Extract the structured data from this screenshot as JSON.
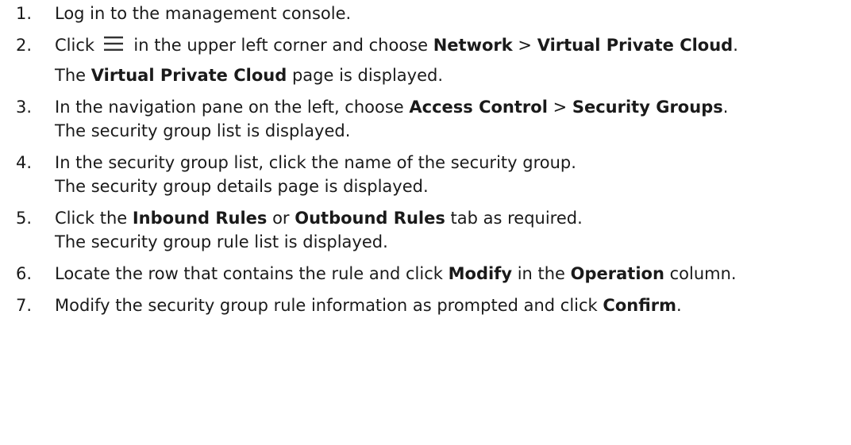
{
  "steps": [
    {
      "number": "1.",
      "text": "Log in to the management console."
    },
    {
      "number": "2.",
      "text_before_icon": "Click ",
      "icon": "menu-icon",
      "text_after_icon": " in the upper left corner and choose ",
      "bold1": "Network",
      "sep": " > ",
      "bold2": "Virtual Private Cloud",
      "end": ".",
      "result_prefix": "The ",
      "result_bold": "Virtual Private Cloud",
      "result_suffix": " page is displayed."
    },
    {
      "number": "3.",
      "text_before": "In the navigation pane on the left, choose ",
      "bold1": "Access Control",
      "sep": " > ",
      "bold2": "Security Groups",
      "end": ".",
      "result": "The security group list is displayed."
    },
    {
      "number": "4.",
      "text": "In the security group list, click the name of the security group.",
      "result": "The security group details page is displayed."
    },
    {
      "number": "5.",
      "text_before": "Click the ",
      "bold1": "Inbound Rules",
      "mid": " or ",
      "bold2": "Outbound Rules",
      "end": " tab as required.",
      "result": "The security group rule list is displayed."
    },
    {
      "number": "6.",
      "text_before": "Locate the row that contains the rule and click ",
      "bold1": "Modify",
      "mid": " in the ",
      "bold2": "Operation",
      "end": " column."
    },
    {
      "number": "7.",
      "text_before": "Modify the security group rule information as prompted and click ",
      "bold1": "Confirm",
      "end": "."
    }
  ]
}
